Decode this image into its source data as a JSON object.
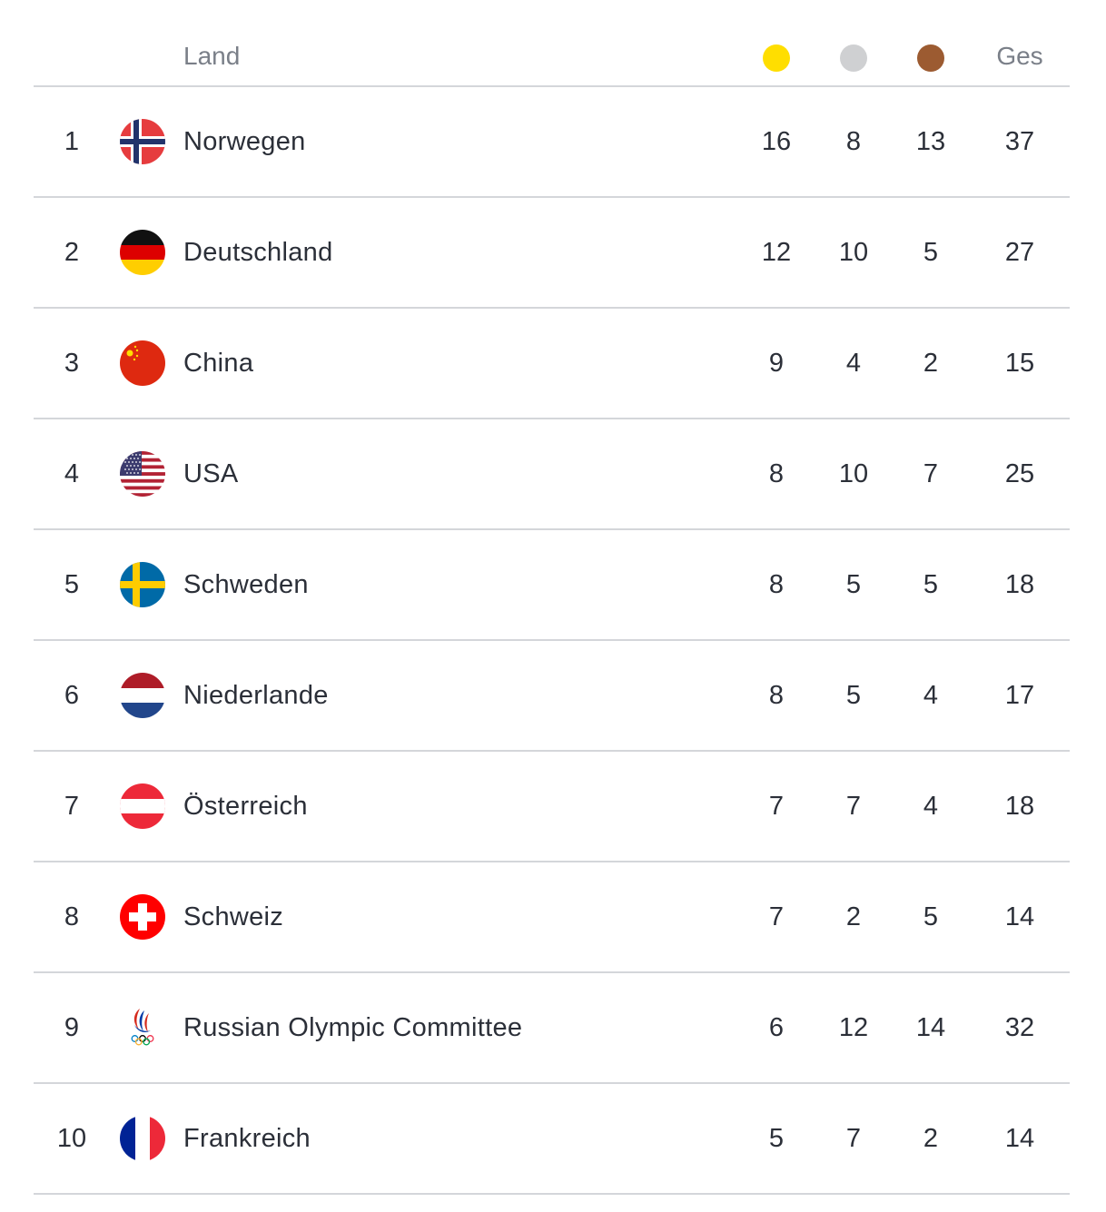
{
  "header": {
    "country_label": "Land",
    "total_label": "Ges",
    "medal_colors": {
      "gold": "#ffde00",
      "silver": "#cfd0d2",
      "bronze": "#9c5b31"
    }
  },
  "rows": [
    {
      "rank": "1",
      "country": "Norwegen",
      "flag": "norway-flag-icon",
      "gold": "16",
      "silver": "8",
      "bronze": "13",
      "total": "37"
    },
    {
      "rank": "2",
      "country": "Deutschland",
      "flag": "germany-flag-icon",
      "gold": "12",
      "silver": "10",
      "bronze": "5",
      "total": "27"
    },
    {
      "rank": "3",
      "country": "China",
      "flag": "china-flag-icon",
      "gold": "9",
      "silver": "4",
      "bronze": "2",
      "total": "15"
    },
    {
      "rank": "4",
      "country": "USA",
      "flag": "usa-flag-icon",
      "gold": "8",
      "silver": "10",
      "bronze": "7",
      "total": "25"
    },
    {
      "rank": "5",
      "country": "Schweden",
      "flag": "sweden-flag-icon",
      "gold": "8",
      "silver": "5",
      "bronze": "5",
      "total": "18"
    },
    {
      "rank": "6",
      "country": "Niederlande",
      "flag": "netherlands-flag-icon",
      "gold": "8",
      "silver": "5",
      "bronze": "4",
      "total": "17"
    },
    {
      "rank": "7",
      "country": "Österreich",
      "flag": "austria-flag-icon",
      "gold": "7",
      "silver": "7",
      "bronze": "4",
      "total": "18"
    },
    {
      "rank": "8",
      "country": "Schweiz",
      "flag": "switzerland-flag-icon",
      "gold": "7",
      "silver": "2",
      "bronze": "5",
      "total": "14"
    },
    {
      "rank": "9",
      "country": "Russian Olympic Committee",
      "flag": "roc-emblem-icon",
      "gold": "6",
      "silver": "12",
      "bronze": "14",
      "total": "32"
    },
    {
      "rank": "10",
      "country": "Frankreich",
      "flag": "france-flag-icon",
      "gold": "5",
      "silver": "7",
      "bronze": "2",
      "total": "14"
    }
  ]
}
